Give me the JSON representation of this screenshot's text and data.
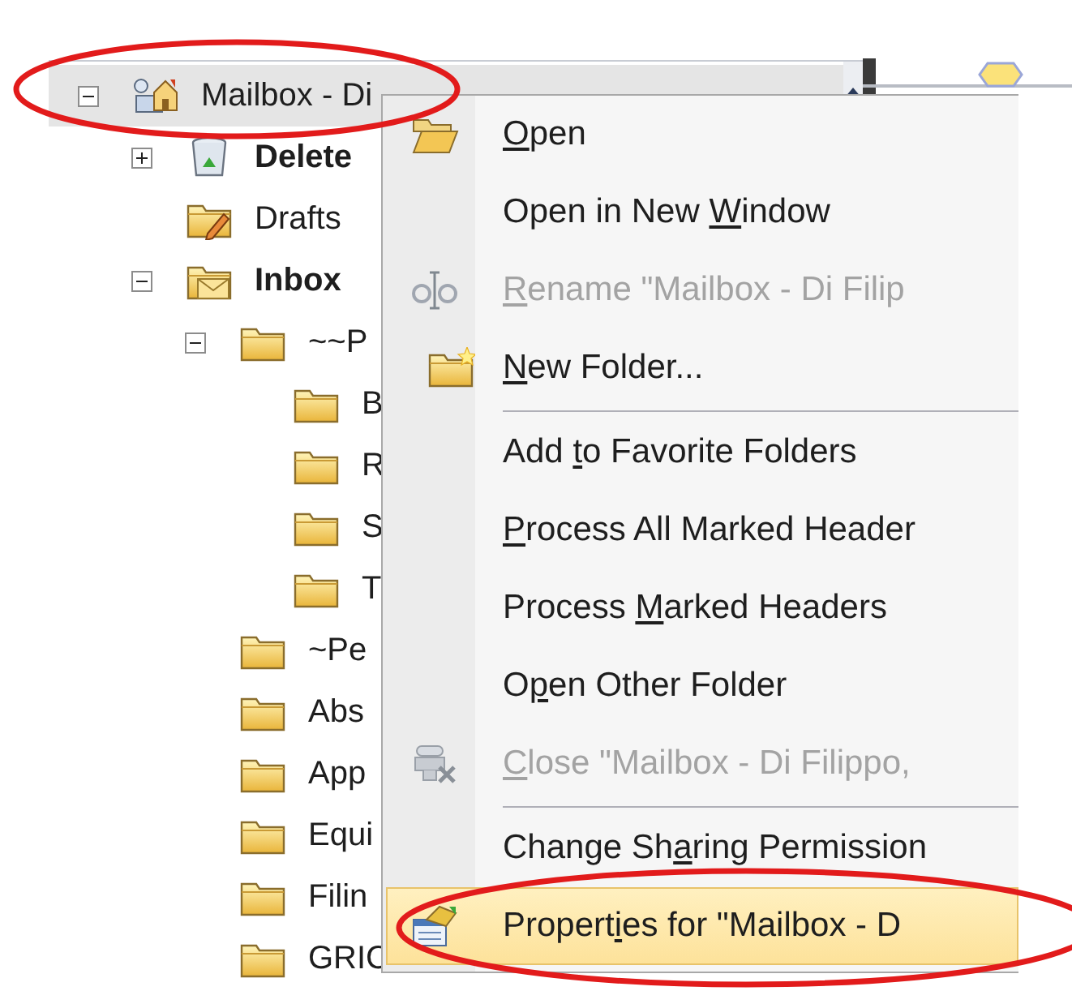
{
  "folder_tree": [
    {
      "label": "Mailbox - Di",
      "kind": "mailbox",
      "bold": false,
      "selected": true,
      "expanded": true,
      "children": [
        {
          "label": "Delete",
          "kind": "trash",
          "bold": true,
          "selected": false,
          "expanded": false
        },
        {
          "label": "Drafts",
          "kind": "drafts",
          "bold": false,
          "selected": false
        },
        {
          "label": "Inbox",
          "kind": "inbox",
          "bold": true,
          "selected": false,
          "expanded": true,
          "children": [
            {
              "label": "~~P",
              "kind": "folder",
              "bold": false,
              "selected": false,
              "expanded": true,
              "children": [
                {
                  "label": "B",
                  "kind": "folder",
                  "bold": false,
                  "selected": false
                },
                {
                  "label": "R",
                  "kind": "folder",
                  "bold": false,
                  "selected": false
                },
                {
                  "label": "S",
                  "kind": "folder",
                  "bold": false,
                  "selected": false
                },
                {
                  "label": "T",
                  "kind": "folder",
                  "bold": false,
                  "selected": false
                }
              ]
            },
            {
              "label": "~Pe",
              "kind": "folder",
              "bold": false,
              "selected": false
            },
            {
              "label": "Abs",
              "kind": "folder",
              "bold": false,
              "selected": false
            },
            {
              "label": "App",
              "kind": "folder",
              "bold": false,
              "selected": false
            },
            {
              "label": "Equi",
              "kind": "folder",
              "bold": false,
              "selected": false
            },
            {
              "label": "Filin",
              "kind": "folder",
              "bold": false,
              "selected": false
            },
            {
              "label": "GRIC",
              "kind": "folder",
              "bold": false,
              "selected": false
            }
          ]
        }
      ]
    }
  ],
  "context_menu": [
    {
      "kind": "item",
      "label": {
        "key": "O",
        "after": "pen"
      },
      "disabled": false,
      "selected": false
    },
    {
      "kind": "item",
      "label": {
        "before": "Open in New ",
        "key": "W",
        "after": "indow"
      },
      "disabled": false,
      "selected": false
    },
    {
      "kind": "item",
      "label": {
        "key": "R",
        "after": "ename \"Mailbox - Di Filip"
      },
      "disabled": true,
      "selected": false
    },
    {
      "kind": "item",
      "label": {
        "key": "N",
        "after": "ew Folder..."
      },
      "disabled": false,
      "selected": false
    },
    {
      "kind": "separator"
    },
    {
      "kind": "item",
      "label": {
        "before": "Add ",
        "key": "t",
        "after": "o Favorite Folders"
      },
      "disabled": false,
      "selected": false
    },
    {
      "kind": "item",
      "label": {
        "key": "P",
        "after": "rocess All Marked Header"
      },
      "disabled": false,
      "selected": false
    },
    {
      "kind": "item",
      "label": {
        "before": "Process ",
        "key": "M",
        "after": "arked Headers"
      },
      "disabled": false,
      "selected": false
    },
    {
      "kind": "item",
      "label": {
        "before": "O",
        "key": "p",
        "after": "en Other Folder"
      },
      "disabled": false,
      "selected": false
    },
    {
      "kind": "item",
      "label": {
        "key": "C",
        "after": "lose \"Mailbox - Di Filippo,"
      },
      "disabled": true,
      "selected": false
    },
    {
      "kind": "separator"
    },
    {
      "kind": "item",
      "label": {
        "before": "Change Sh",
        "key": "a",
        "after": "ring Permission"
      },
      "disabled": false,
      "selected": false
    },
    {
      "kind": "item",
      "label": {
        "before": "Propert",
        "key": "i",
        "after": "es for \"Mailbox - D"
      },
      "disabled": false,
      "selected": true
    }
  ],
  "annotations": [
    {
      "kind": "ellipse"
    },
    {
      "kind": "ellipse"
    }
  ]
}
